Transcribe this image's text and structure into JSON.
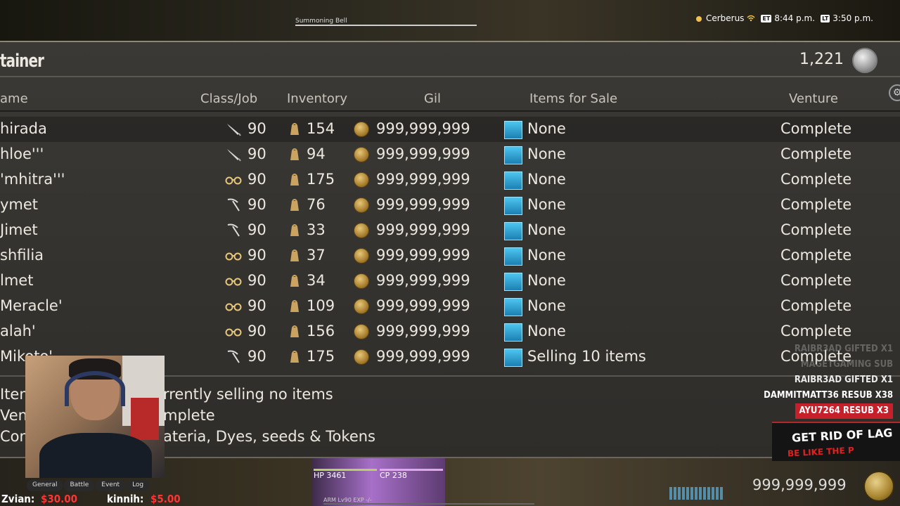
{
  "top": {
    "target_name": "Summoning Bell",
    "server": "Cerberus",
    "et_badge": "ET",
    "et_time": "8:44 p.m.",
    "lt_badge": "LT",
    "lt_time": "3:50 p.m."
  },
  "window": {
    "title": "tainer",
    "gil_total": "1,221",
    "columns": {
      "name": "ame",
      "class_job": "Class/Job",
      "inventory": "Inventory",
      "gil": "Gil",
      "items_for_sale": "Items for Sale",
      "venture": "Venture"
    },
    "rows": [
      {
        "name": "hirada",
        "class_icon": "quill-icon",
        "level": "90",
        "inventory": "154",
        "gil": "999,999,999",
        "sale": "None",
        "venture": "Complete"
      },
      {
        "name": "hloe'''",
        "class_icon": "quill-icon",
        "level": "90",
        "inventory": "94",
        "gil": "999,999,999",
        "sale": "None",
        "venture": "Complete"
      },
      {
        "name": "'mhitra'''",
        "class_icon": "glasses-icon",
        "level": "90",
        "inventory": "175",
        "gil": "999,999,999",
        "sale": "None",
        "venture": "Complete"
      },
      {
        "name": "ymet",
        "class_icon": "pickaxe-icon",
        "level": "90",
        "inventory": "76",
        "gil": "999,999,999",
        "sale": "None",
        "venture": "Complete"
      },
      {
        "name": "Jimet",
        "class_icon": "pickaxe-icon",
        "level": "90",
        "inventory": "33",
        "gil": "999,999,999",
        "sale": "None",
        "venture": "Complete"
      },
      {
        "name": "shfilia",
        "class_icon": "glasses-icon",
        "level": "90",
        "inventory": "37",
        "gil": "999,999,999",
        "sale": "None",
        "venture": "Complete"
      },
      {
        "name": "lmet",
        "class_icon": "glasses-icon",
        "level": "90",
        "inventory": "34",
        "gil": "999,999,999",
        "sale": "None",
        "venture": "Complete"
      },
      {
        "name": "Meracle'",
        "class_icon": "glasses-icon",
        "level": "90",
        "inventory": "109",
        "gil": "999,999,999",
        "sale": "None",
        "venture": "Complete"
      },
      {
        "name": "alah'",
        "class_icon": "glasses-icon",
        "level": "90",
        "inventory": "156",
        "gil": "999,999,999",
        "sale": "None",
        "venture": "Complete"
      },
      {
        "name": "Mikoto'",
        "class_icon": "pickaxe-icon",
        "level": "90",
        "inventory": "175",
        "gil": "999,999,999",
        "sale": "Selling 10 items",
        "venture": "Complete"
      }
    ],
    "info": {
      "items_label": "Item",
      "items_value": "rrently selling no items",
      "venture_label": "Vent",
      "venture_value": "mplete",
      "comment_label": "Com",
      "comment_value": "ateria, Dyes, seeds & Tokens"
    }
  },
  "chat": {
    "tabs": [
      "General",
      "Battle",
      "Event",
      "Log"
    ]
  },
  "donations": [
    {
      "name": "Zvian:",
      "amount": "$30.00"
    },
    {
      "name": "kinnih:",
      "amount": "$5.00"
    }
  ],
  "hud": {
    "hp_label": "HP",
    "hp_value": "3461",
    "cp_label": "CP",
    "cp_value": "238",
    "exp_text": "ARM Lv90  EXP -/-"
  },
  "alerts": [
    "RAIBR3AD GIFTED X1",
    "MAGETGAMING SUB",
    "RAIBR3AD GIFTED X1",
    "DAMMITMATT36 RESUB X38",
    "AYU7264 RESUB X3"
  ],
  "ad": {
    "line1": "GET RID OF LAG",
    "line2": "BE LIKE THE P"
  },
  "bottom_gil": "999,999,999",
  "colors": {
    "window_bg": "#33312d",
    "text": "#ece8df",
    "sale_icon": "#2fa3d6",
    "alert_red": "#c6212a"
  }
}
